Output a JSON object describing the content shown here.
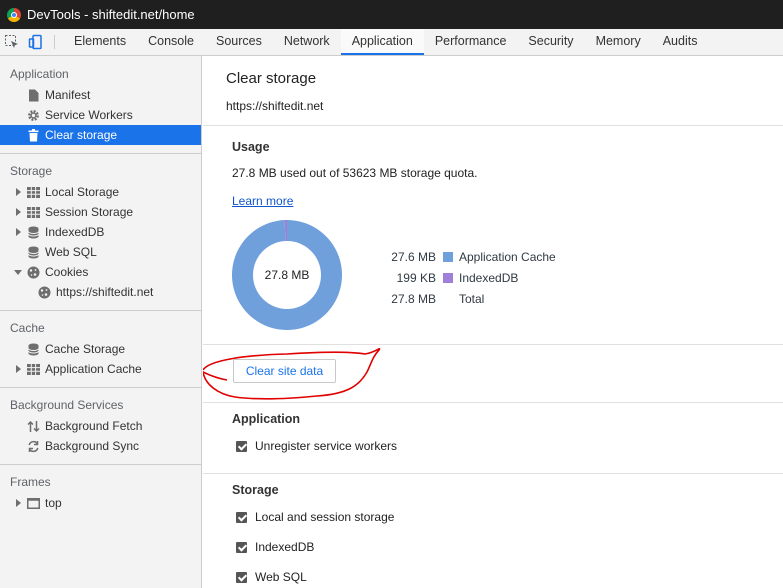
{
  "window": {
    "title": "DevTools - shiftedit.net/home"
  },
  "tabs": [
    "Elements",
    "Console",
    "Sources",
    "Network",
    "Application",
    "Performance",
    "Security",
    "Memory",
    "Audits"
  ],
  "active_tab": "Application",
  "sidebar": {
    "application": {
      "title": "Application",
      "items": [
        "Manifest",
        "Service Workers",
        "Clear storage"
      ]
    },
    "storage": {
      "title": "Storage",
      "items": [
        "Local Storage",
        "Session Storage",
        "IndexedDB",
        "Web SQL",
        "Cookies"
      ],
      "cookie_child": "https://shiftedit.net"
    },
    "cache": {
      "title": "Cache",
      "items": [
        "Cache Storage",
        "Application Cache"
      ]
    },
    "background": {
      "title": "Background Services",
      "items": [
        "Background Fetch",
        "Background Sync"
      ]
    },
    "frames": {
      "title": "Frames",
      "items": [
        "top"
      ]
    }
  },
  "main": {
    "title": "Clear storage",
    "origin": "https://shiftedit.net",
    "usage": {
      "heading": "Usage",
      "summary": "27.8 MB used out of 53623 MB storage quota.",
      "learn_more": "Learn more",
      "donut_label": "27.8 MB",
      "legend": [
        {
          "size": "27.6 MB",
          "label": "Application Cache",
          "color": "#6fa0dc"
        },
        {
          "size": "199 KB",
          "label": "IndexedDB",
          "color": "#9f80d8"
        },
        {
          "size": "27.8 MB",
          "label": "Total"
        }
      ],
      "slices": [
        {
          "label": "Application Cache",
          "bytes_mb": 27.6,
          "color": "#6fa0dc"
        },
        {
          "label": "IndexedDB",
          "bytes_mb": 0.199,
          "color": "#9f80d8"
        }
      ]
    },
    "clear_button": "Clear site data",
    "application_section": {
      "heading": "Application",
      "checks": [
        "Unregister service workers"
      ]
    },
    "storage_section": {
      "heading": "Storage",
      "checks": [
        "Local and session storage",
        "IndexedDB",
        "Web SQL"
      ]
    },
    "annotation_color": "#e00000"
  }
}
